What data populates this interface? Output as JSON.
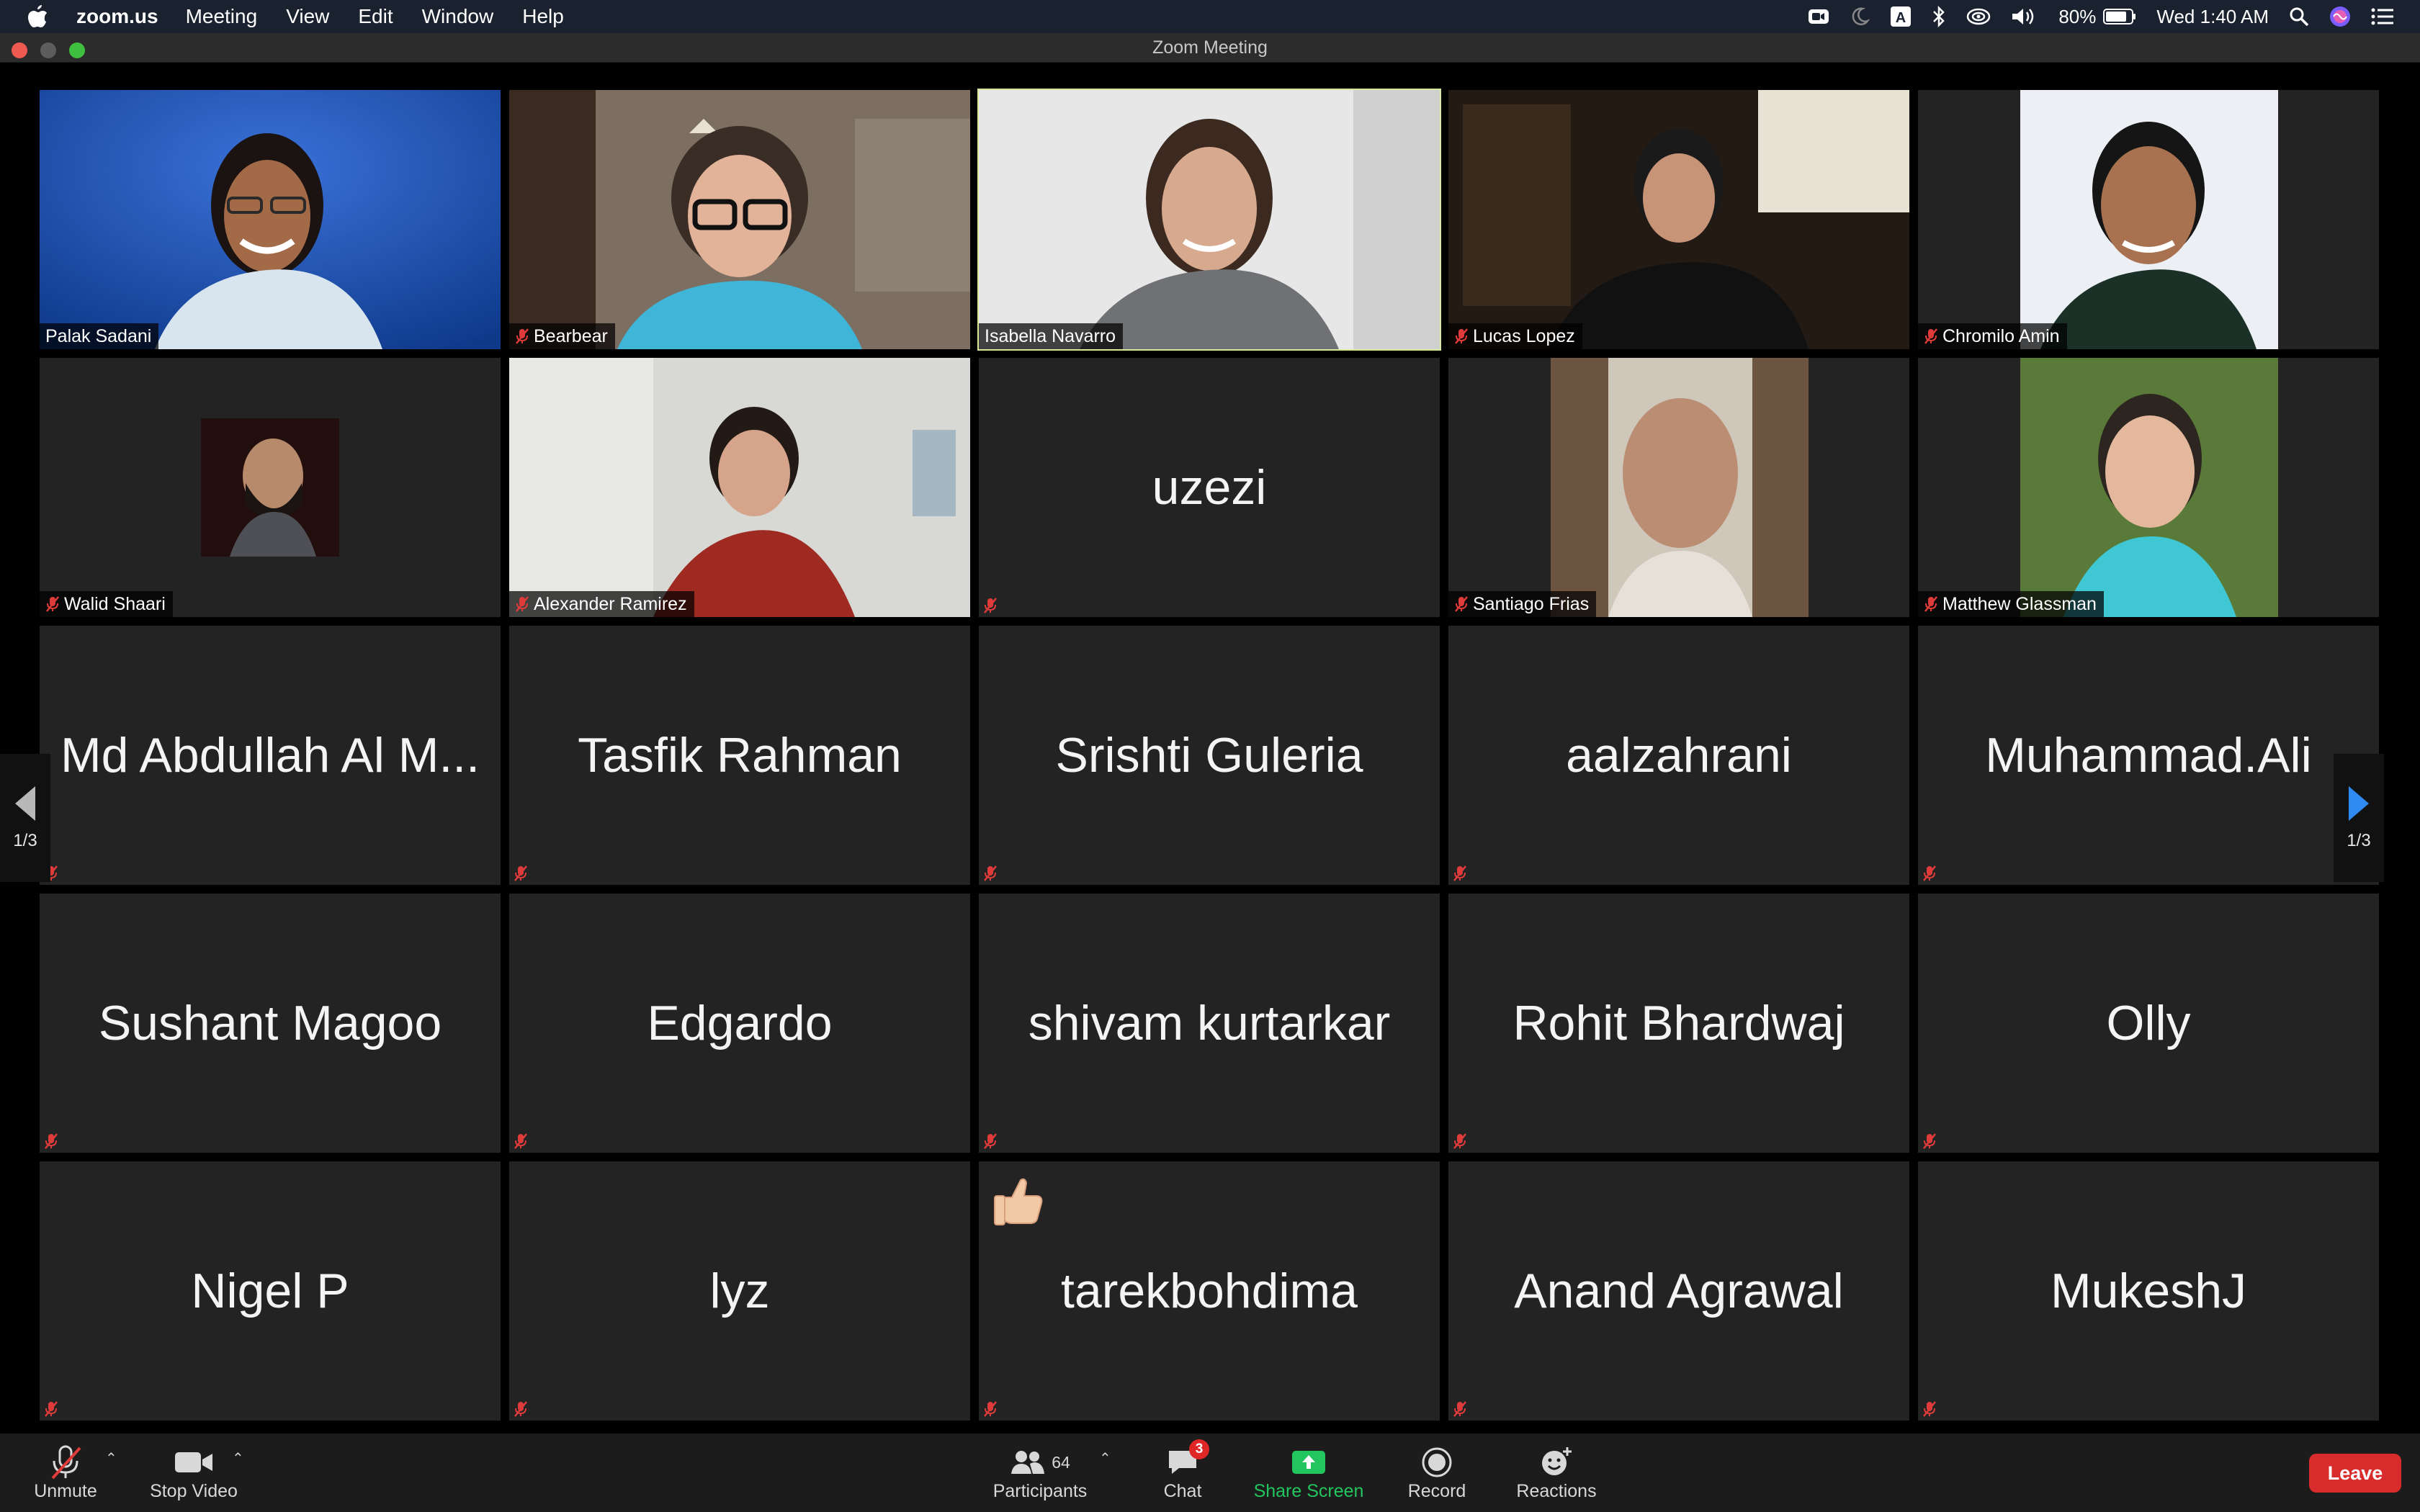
{
  "menubar": {
    "app_name": "zoom.us",
    "menus": [
      "Meeting",
      "View",
      "Edit",
      "Window",
      "Help"
    ],
    "battery": "80%",
    "clock": "Wed 1:40 AM"
  },
  "window": {
    "title": "Zoom Meeting"
  },
  "gallery": {
    "page_left": "1/3",
    "page_right": "1/3",
    "tiles": [
      {
        "name": "Palak Sadani"
      },
      {
        "name": "Bearbear"
      },
      {
        "name": "Isabella Navarro"
      },
      {
        "name": "Lucas Lopez"
      },
      {
        "name": "Chromilo Amin"
      },
      {
        "name": "Walid Shaari"
      },
      {
        "name": "Alexander Ramirez"
      },
      {
        "name": "uzezi"
      },
      {
        "name": "Santiago Frias"
      },
      {
        "name": "Matthew Glassman"
      },
      {
        "name": "Md Abdullah Al M..."
      },
      {
        "name": "Tasfik Rahman"
      },
      {
        "name": "Srishti Guleria"
      },
      {
        "name": "aalzahrani"
      },
      {
        "name": "Muhammad.Ali"
      },
      {
        "name": "Sushant Magoo"
      },
      {
        "name": "Edgardo"
      },
      {
        "name": "shivam kurtarkar"
      },
      {
        "name": "Rohit Bhardwaj"
      },
      {
        "name": "Olly"
      },
      {
        "name": "Nigel P"
      },
      {
        "name": "lyz"
      },
      {
        "name": "tarekbohdima"
      },
      {
        "name": "Anand Agrawal"
      },
      {
        "name": "MukeshJ"
      }
    ]
  },
  "toolbar": {
    "unmute": "Unmute",
    "stop_video": "Stop Video",
    "participants": "Participants",
    "participants_count": "64",
    "chat": "Chat",
    "chat_badge": "3",
    "share_screen": "Share Screen",
    "record": "Record",
    "reactions": "Reactions",
    "leave": "Leave"
  },
  "colors": {
    "share_screen_green": "#22c55e",
    "leave_red": "#d82b2b",
    "active_speaker_border": "#d6e89a",
    "muted_mic_red": "#e03b3b"
  }
}
